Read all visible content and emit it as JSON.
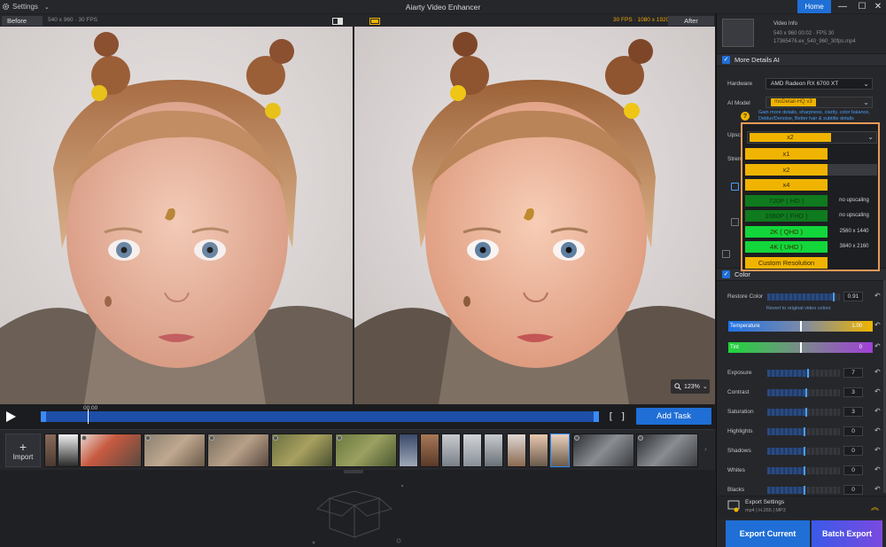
{
  "titlebar": {
    "settings_label": "Settings",
    "app_title": "Aiarty Video Enhancer",
    "home_label": "Home"
  },
  "preview": {
    "before_label": "Before",
    "before_info": "540 x 960 · 30 FPS",
    "after_info": "30 FPS · 1080 x 1920",
    "after_label": "After",
    "zoom_level": "123%"
  },
  "timeline": {
    "time": "00:00",
    "bracket_in": "[",
    "bracket_out": "]",
    "add_task_label": "Add Task"
  },
  "filmstrip": {
    "import_plus": "+",
    "import_label": "Import"
  },
  "panel": {
    "video_info": {
      "title": "Video Info",
      "line1": "540 x 960 00:02 · FPS 30",
      "line2": "17365476.ex_540_960_30fps.mp4"
    },
    "more_details": {
      "check": "✓",
      "label": "More Details AI",
      "hardware_label": "Hardware",
      "hardware_value": "AMD Radeon RX 6700 XT",
      "model_label": "AI Model",
      "model_value": "moDetail-HQ  v3",
      "hint1": "Gain more details, sharpness, clarity, color balance,",
      "hint2": "Deblur/Denoise, Better hair & subtitle details",
      "upscale_label": "Upscale",
      "strength_label": "Stren",
      "help": "?"
    },
    "color": {
      "check": "✓",
      "label": "Color",
      "restore_label": "Restore Color",
      "restore_value": "0.91",
      "restore_hint": "Revert to original video colors",
      "temperature_label": "Temperature",
      "temperature_value": "1.00",
      "tint_label": "Tint",
      "tint_value": "0",
      "adjustments": [
        {
          "name": "Exposure",
          "value": "7",
          "level": 0.55
        },
        {
          "name": "Contrast",
          "value": "3",
          "level": 0.53
        },
        {
          "name": "Saturation",
          "value": "3",
          "level": 0.53
        },
        {
          "name": "Highlights",
          "value": "0",
          "level": 0.5
        },
        {
          "name": "Shadows",
          "value": "0",
          "level": 0.5
        },
        {
          "name": "Whites",
          "value": "0",
          "level": 0.5
        },
        {
          "name": "Blacks",
          "value": "0",
          "level": 0.5
        }
      ]
    },
    "export": {
      "title": "Export Settings",
      "sub": "mp4 | H.265 | MP3",
      "export_current": "Export Current",
      "batch_export": "Batch Export"
    }
  },
  "upscale_dropdown": {
    "selected": "x2",
    "options": [
      {
        "label": "x1",
        "note": "",
        "color": "#f0b400"
      },
      {
        "label": "x2",
        "note": "",
        "color": "#f0b400"
      },
      {
        "label": "x4",
        "note": "",
        "color": "#f0b400"
      },
      {
        "label": "720P ( HD )",
        "note": "no upscaling",
        "color": "#0f7a1e"
      },
      {
        "label": "1080P ( FHD )",
        "note": "no upscaling",
        "color": "#0f7a1e"
      },
      {
        "label": "2K ( QHD )",
        "note": "2560 x 1440",
        "color": "#12d63a"
      },
      {
        "label": "4K ( UHD )",
        "note": "3840 x 2160",
        "color": "#12d63a"
      },
      {
        "label": "Custom Resolution",
        "note": "",
        "color": "#f0b400"
      }
    ]
  },
  "colors": {
    "accent": "#1f6fd6",
    "highlight_orange": "#e89a58",
    "option_yellow": "#f0b400"
  }
}
